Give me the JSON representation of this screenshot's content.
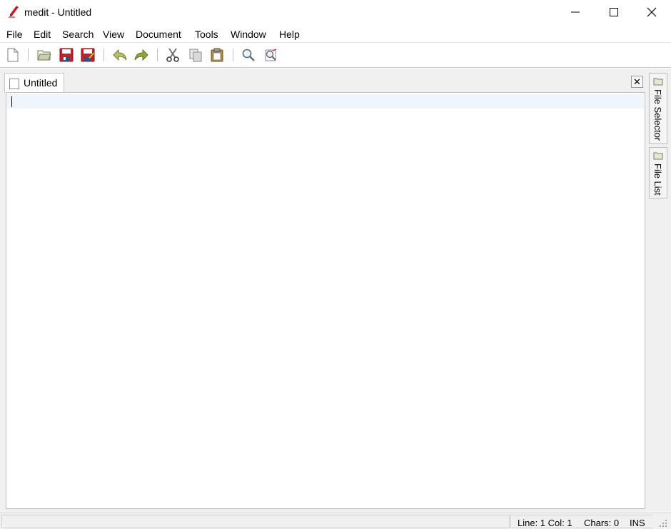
{
  "window": {
    "title": "medit - Untitled",
    "controls": [
      "minimize",
      "maximize",
      "close"
    ]
  },
  "menu": {
    "items": [
      "File",
      "Edit",
      "Search",
      "View",
      "Document",
      "Tools",
      "Window",
      "Help"
    ]
  },
  "toolbar": {
    "buttons": [
      "new-document-icon",
      "open-folder-icon",
      "save-icon",
      "save-as-icon",
      "undo-icon",
      "redo-icon",
      "cut-icon",
      "copy-icon",
      "paste-icon",
      "find-icon",
      "find-replace-icon"
    ]
  },
  "document": {
    "tab_label": "Untitled",
    "close_glyph": "✕"
  },
  "side_panel": {
    "tabs": [
      "File Selector",
      "File List"
    ]
  },
  "status": {
    "position": "Line: 1 Col: 1",
    "chars": "Chars: 0",
    "mode": "INS"
  },
  "colors": {
    "accent_red": "#c8202a",
    "current_line": "#eef5fd",
    "arrow_green": "#8fa83a"
  }
}
